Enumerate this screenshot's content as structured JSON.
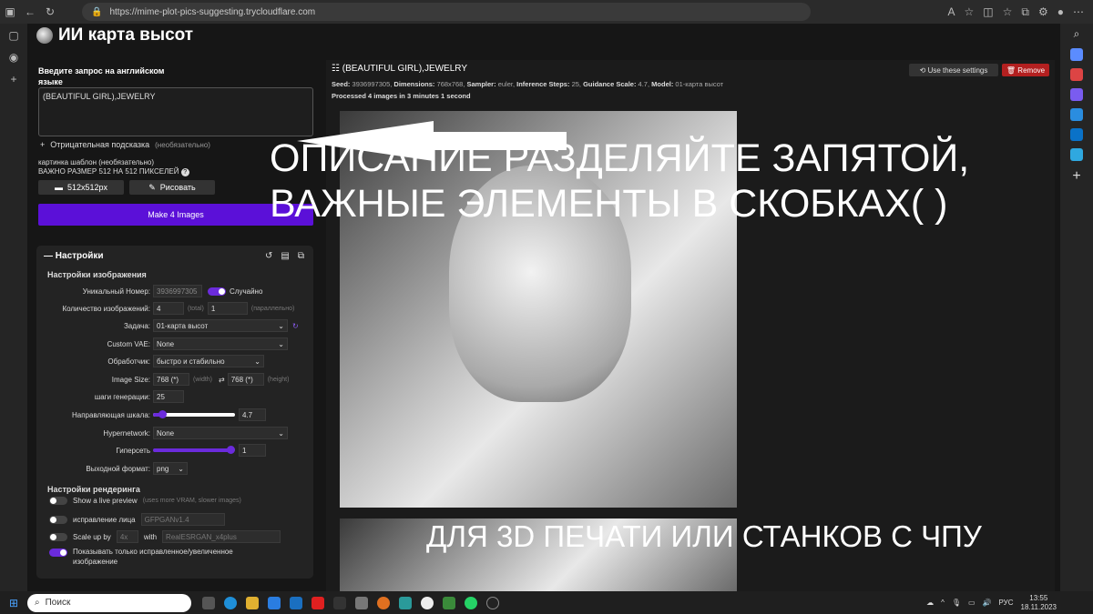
{
  "browser": {
    "url": "https://mime-plot-pics-suggesting.trycloudflare.com"
  },
  "app": {
    "title": "ИИ карта высот"
  },
  "prompt": {
    "label": "Введите запрос на английском языке",
    "value": "(BEAUTIFUL GIRL),JEWELRY",
    "negative_label": "Отрицательная подсказка",
    "negative_hint": "(необязательно)",
    "template_label": "картинка шаблон",
    "template_hint": "(необязательно)",
    "template_note": "ВАЖНО РАЗМЕР 512 НА 512 ПИКСЕЛЕЙ",
    "size_button": "512x512px",
    "draw_button": "Рисовать",
    "make_button": "Make 4 Images"
  },
  "settings": {
    "header": "Настройки",
    "image_section": "Настройки изображения",
    "seed_label": "Уникальный Номер:",
    "seed_value": "3936997305",
    "random_label": "Случайно",
    "count_label": "Количество изображений:",
    "count_value": "4",
    "count_total": "(total)",
    "parallel_value": "1",
    "parallel_label": "(параллельно)",
    "task_label": "Задача:",
    "task_value": "01-карта высот",
    "vae_label": "Custom VAE:",
    "vae_value": "None",
    "sampler_label": "Обработчик:",
    "sampler_value": "быстро и стабильно",
    "size_label": "Image Size:",
    "width_value": "768 (*)",
    "width_hint": "(width)",
    "height_value": "768 (*)",
    "height_hint": "(height)",
    "steps_label": "шаги генерации:",
    "steps_value": "25",
    "guidance_label": "Направляющая шкала:",
    "guidance_value": "4.7",
    "guidance_fraction": 0.08,
    "hyper_label": "Hypernetwork:",
    "hyper_value": "None",
    "hyperstrength_label": "Гиперсеть",
    "hyperstrength_value": "1",
    "hyperstrength_fraction": 1.0,
    "format_label": "Выходной формат:",
    "format_value": "png",
    "render_section": "Настройки рендеринга",
    "live_label": "Show a live preview",
    "live_hint": "(uses more VRAM, slower images)",
    "face_label": "исправление лица",
    "face_value": "GFPGANv1.4",
    "scale_label": "Scale up by",
    "scale_value": "4x",
    "scale_with": "with",
    "scale_model": "RealESRGAN_x4plus",
    "only_fixed_label": "Показывать только исправленное/увеличенное изображение"
  },
  "result": {
    "title": "(BEAUTIFUL GIRL),JEWELRY",
    "seed_key": "Seed:",
    "seed": "3936997305",
    "dim_key": "Dimensions:",
    "dim": "768x768",
    "sampler_key": "Sampler:",
    "sampler": "euler",
    "steps_key": "Inference Steps:",
    "steps": "25",
    "scale_key": "Guidance Scale:",
    "scale": "4.7",
    "model_key": "Model:",
    "model": "01-карта высот",
    "processed": "Processed 4 images in 3 minutes 1 second",
    "use_button": "Use these settings",
    "remove_button": "Remove"
  },
  "overlay": {
    "line1": "ОПИСАНИЕ РАЗДЕЛЯЙТЕ ЗАПЯТОЙ,",
    "line2": "ВАЖНЫЕ ЭЛЕМЕНТЫ  В СКОБКАХ( )",
    "bottom": "ДЛЯ 3D ПЕЧАТИ ИЛИ СТАНКОВ С ЧПУ"
  },
  "taskbar": {
    "search": "Поиск",
    "lang": "РУС",
    "time": "13:55",
    "date": "18.11.2023"
  }
}
